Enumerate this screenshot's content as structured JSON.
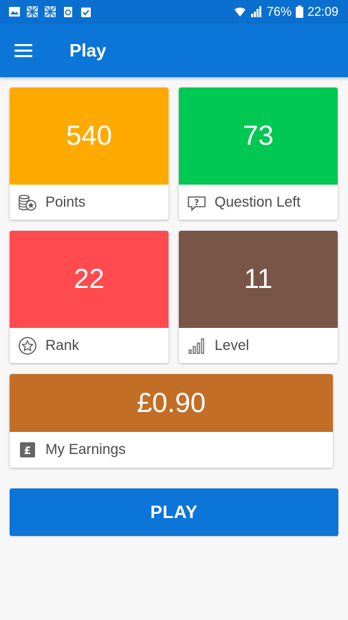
{
  "status_bar": {
    "battery_percent": "76%",
    "time": "22:09"
  },
  "app_bar": {
    "title": "Play"
  },
  "stats": {
    "points": {
      "value": "540",
      "label": "Points",
      "color": "#ffaa00"
    },
    "questions_left": {
      "value": "73",
      "label": "Question Left",
      "color": "#00c853"
    },
    "rank": {
      "value": "22",
      "label": "Rank",
      "color": "#ff4a50"
    },
    "level": {
      "value": "11",
      "label": "Level",
      "color": "#795548"
    },
    "earnings": {
      "value": "£0.90",
      "label": "My Earnings",
      "color": "#c26e27"
    }
  },
  "play_button": {
    "label": "PLAY"
  },
  "colors": {
    "primary": "#0c75d8",
    "status_bar": "#0b6fcf",
    "background": "#f7f7f7"
  }
}
